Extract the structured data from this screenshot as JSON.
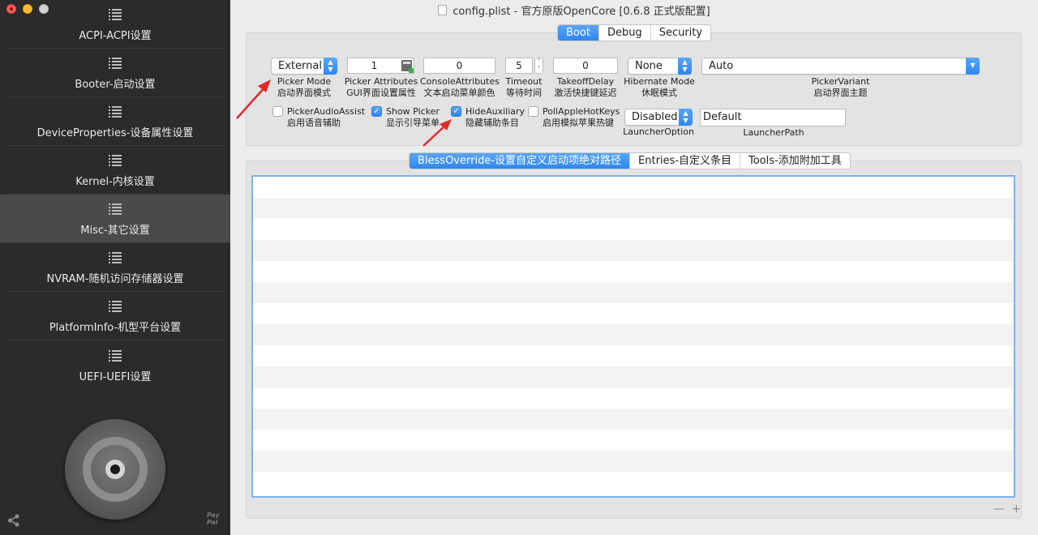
{
  "window": {
    "title": "config.plist - 官方原版OpenCore [0.6.8 正式版配置]"
  },
  "sidebar": {
    "items": [
      {
        "label": "ACPI-ACPI设置"
      },
      {
        "label": "Booter-启动设置"
      },
      {
        "label": "DeviceProperties-设备属性设置"
      },
      {
        "label": "Kernel-内核设置"
      },
      {
        "label": "Misc-其它设置"
      },
      {
        "label": "NVRAM-随机访问存储器设置"
      },
      {
        "label": "PlatformInfo-机型平台设置"
      },
      {
        "label": "UEFI-UEFI设置"
      }
    ],
    "active_index": 4,
    "paypal_text": "Pay Pal"
  },
  "top_tabs": [
    "Boot",
    "Debug",
    "Security"
  ],
  "boot": {
    "picker_mode": {
      "value": "External",
      "caption_en": "Picker Mode",
      "caption_zh": "启动界面模式"
    },
    "picker_attributes": {
      "value": "1",
      "caption_en": "Picker Attributes",
      "caption_zh": "GUI界面设置属性"
    },
    "console_attributes": {
      "value": "0",
      "caption_en": "ConsoleAttributes",
      "caption_zh": "文本启动菜单颜色"
    },
    "timeout": {
      "value": "5",
      "caption_en": "Timeout",
      "caption_zh": "等待时间"
    },
    "takeoff_delay": {
      "value": "0",
      "caption_en": "TakeoffDelay",
      "caption_zh": "激活快捷键延迟"
    },
    "hibernate_mode": {
      "value": "None",
      "caption_en": "Hibernate Mode",
      "caption_zh": "休眠模式"
    },
    "picker_variant": {
      "value": "Auto",
      "caption_en": "PickerVariant",
      "caption_zh": "启动界面主题"
    },
    "picker_audio_assist": {
      "checked": false,
      "label_en": "PickerAudioAssist",
      "label_zh": "启用语音辅助"
    },
    "show_picker": {
      "checked": true,
      "label_en": "Show Picker",
      "label_zh": "显示引导菜单"
    },
    "hide_auxiliary": {
      "checked": true,
      "label_en": "HideAuxiliary",
      "label_zh": "隐藏辅助条目"
    },
    "poll_apple_hotkeys": {
      "checked": false,
      "label_en": "PollAppleHotKeys",
      "label_zh": "启用模拟苹果热键"
    },
    "launcher_option": {
      "value": "Disabled",
      "caption": "LauncherOption"
    },
    "launcher_path": {
      "value": "Default",
      "caption": "LauncherPath"
    }
  },
  "sub_tabs": [
    "BlessOverride-设置自定义启动项绝对路径",
    "Entries-自定义条目",
    "Tools-添加附加工具"
  ],
  "table": {
    "rows": 15
  },
  "add_remove": "— +",
  "colors": {
    "accent": "#2f86f0",
    "sidebar_bg": "#2b2b2b",
    "arrow": "#e5272a"
  }
}
